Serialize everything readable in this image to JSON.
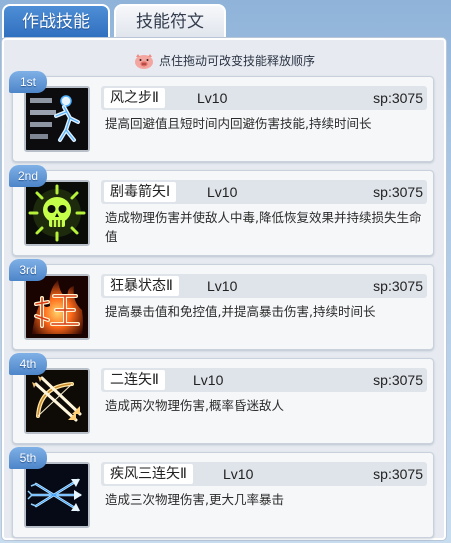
{
  "tabs": [
    {
      "label": "作战技能",
      "active": true
    },
    {
      "label": "技能符文",
      "active": false
    }
  ],
  "hint": {
    "text": "点住拖动可改变技能释放顺序",
    "icon": "pig-mascot-icon"
  },
  "skills": [
    {
      "rank": "1st",
      "name": "风之步Ⅱ",
      "level": "Lv10",
      "sp": "sp:3075",
      "desc": "提高回避值且短时间内回避伤害技能,持续时间长",
      "icon": "wind-step-icon"
    },
    {
      "rank": "2nd",
      "name": "剧毒箭矢Ⅰ",
      "level": "Lv10",
      "sp": "sp:3075",
      "desc": "造成物理伤害并使敌人中毒,降低恢复效果并持续损失生命值",
      "icon": "poison-skull-icon"
    },
    {
      "rank": "3rd",
      "name": "狂暴状态Ⅱ",
      "level": "Lv10",
      "sp": "sp:3075",
      "desc": "提高暴击值和免控值,并提高暴击伤害,持续时间长",
      "icon": "berserk-icon"
    },
    {
      "rank": "4th",
      "name": "二连矢Ⅱ",
      "level": "Lv10",
      "sp": "sp:3075",
      "desc": "造成两次物理伤害,概率昏迷敌人",
      "icon": "double-arrow-icon"
    },
    {
      "rank": "5th",
      "name": "疾风三连矢Ⅱ",
      "level": "Lv10",
      "sp": "sp:3075",
      "desc": "造成三次物理伤害,更大几率暴击",
      "icon": "triple-arrow-icon"
    }
  ],
  "colors": {
    "tab_active": "#3a7dcc",
    "panel_bg": "#e7ebf1",
    "card_bg": "#f6f7f9",
    "rank_badge": "#5a90d0"
  }
}
